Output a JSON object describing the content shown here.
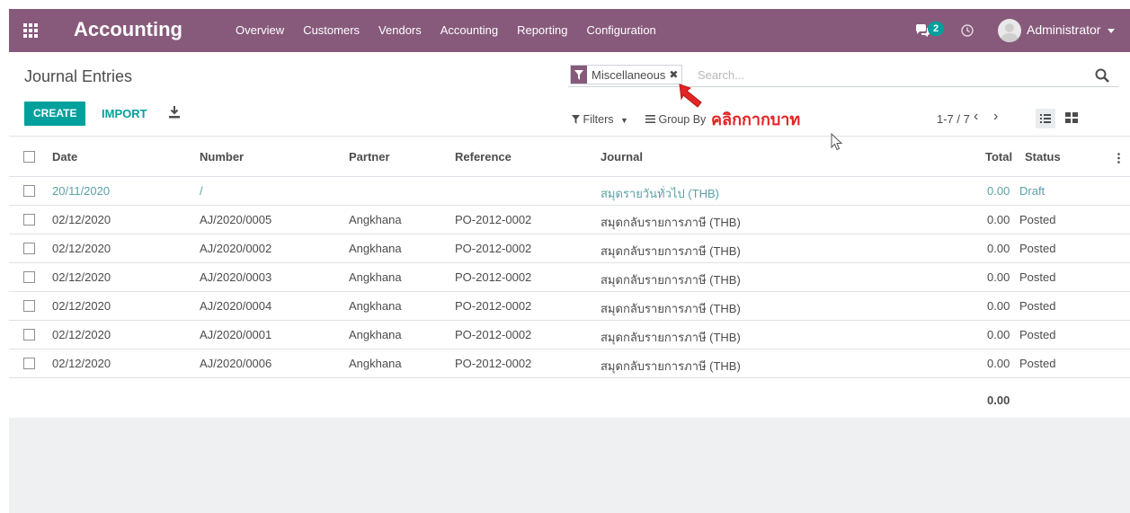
{
  "navbar": {
    "app_title": "Accounting",
    "menu": [
      "Overview",
      "Customers",
      "Vendors",
      "Accounting",
      "Reporting",
      "Configuration"
    ],
    "chat_count": "2",
    "user_name": "Administrator",
    "color": "#875a7b"
  },
  "control_panel": {
    "breadcrumb": "Journal Entries",
    "create_label": "CREATE",
    "import_label": "IMPORT",
    "search": {
      "facet_label": "Miscellaneous",
      "facet_remove": "✖",
      "placeholder": "Search..."
    },
    "filters_label": "Filters",
    "group_by_label": "Group By",
    "annotation": "คลิกกากบาท",
    "pager": "1-7 / 7",
    "pager_prev": "‹",
    "pager_next": "›"
  },
  "table": {
    "columns": [
      "Date",
      "Number",
      "Partner",
      "Reference",
      "Journal",
      "Total",
      "Status"
    ],
    "rows": [
      {
        "date": "20/11/2020",
        "number": "/",
        "partner": "",
        "reference": "",
        "journal": "สมุดรายวันทั่วไป (THB)",
        "total": "0.00",
        "status": "Draft"
      },
      {
        "date": "02/12/2020",
        "number": "AJ/2020/0005",
        "partner": "Angkhana",
        "reference": "PO-2012-0002",
        "journal": "สมุดกลับรายการภาษี (THB)",
        "total": "0.00",
        "status": "Posted"
      },
      {
        "date": "02/12/2020",
        "number": "AJ/2020/0002",
        "partner": "Angkhana",
        "reference": "PO-2012-0002",
        "journal": "สมุดกลับรายการภาษี (THB)",
        "total": "0.00",
        "status": "Posted"
      },
      {
        "date": "02/12/2020",
        "number": "AJ/2020/0003",
        "partner": "Angkhana",
        "reference": "PO-2012-0002",
        "journal": "สมุดกลับรายการภาษี (THB)",
        "total": "0.00",
        "status": "Posted"
      },
      {
        "date": "02/12/2020",
        "number": "AJ/2020/0004",
        "partner": "Angkhana",
        "reference": "PO-2012-0002",
        "journal": "สมุดกลับรายการภาษี (THB)",
        "total": "0.00",
        "status": "Posted"
      },
      {
        "date": "02/12/2020",
        "number": "AJ/2020/0001",
        "partner": "Angkhana",
        "reference": "PO-2012-0002",
        "journal": "สมุดกลับรายการภาษี (THB)",
        "total": "0.00",
        "status": "Posted"
      },
      {
        "date": "02/12/2020",
        "number": "AJ/2020/0006",
        "partner": "Angkhana",
        "reference": "PO-2012-0002",
        "journal": "สมุดกลับรายการภาษี (THB)",
        "total": "0.00",
        "status": "Posted"
      }
    ],
    "grand_total": "0.00"
  }
}
